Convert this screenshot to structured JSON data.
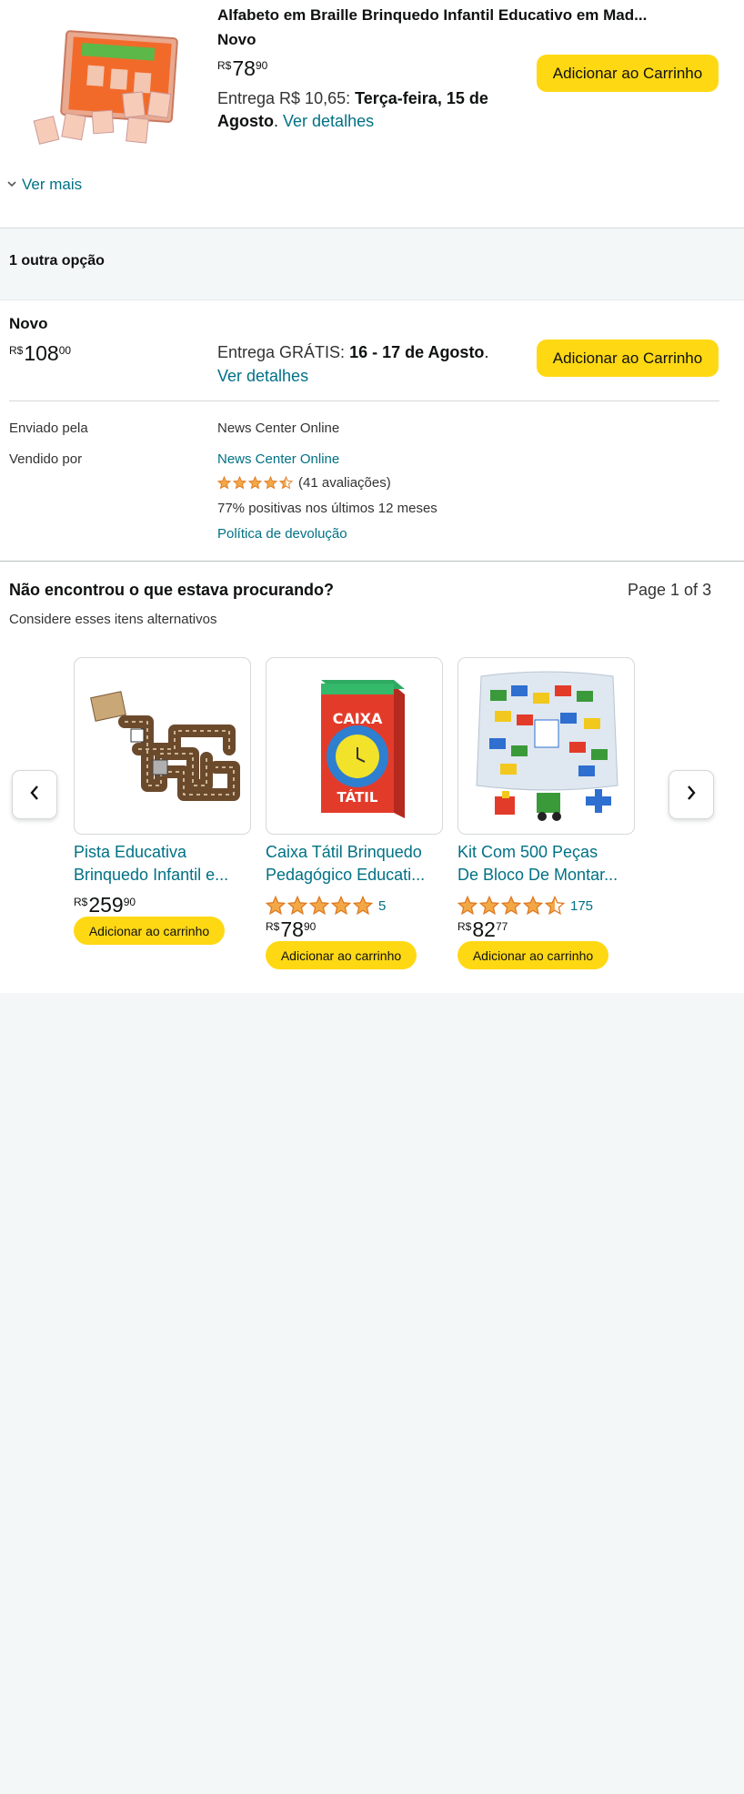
{
  "product": {
    "title": "Alfabeto em Braille Brinquedo Infantil Educativo em Mad...",
    "condition": "Novo",
    "price": {
      "currency": "R$",
      "whole": "78",
      "cents": "90"
    },
    "delivery_prefix": "Entrega R$ 10,65: ",
    "delivery_date_line1": "Terça-feira, 15 de",
    "delivery_date_line2": "Agosto",
    "delivery_period": ". ",
    "details_link": "Ver detalhes",
    "add_to_cart": "Adicionar ao Carrinho"
  },
  "see_more": "Ver mais",
  "other_options": {
    "heading": "1 outra opção",
    "offer": {
      "condition": "Novo",
      "price": {
        "currency": "R$",
        "whole": "108",
        "cents": "00"
      },
      "delivery_prefix": "Entrega GRÁTIS: ",
      "delivery_dates": "16 - 17 de Agosto",
      "delivery_period": ".",
      "details_link": "Ver detalhes",
      "add_to_cart": "Adicionar ao Carrinho",
      "shipped_by_label": "Enviado pela",
      "shipped_by_value": "News Center Online",
      "sold_by_label": "Vendido por",
      "sold_by_value": "News Center Online",
      "rating_stars": 4.5,
      "rating_count": "(41 avaliações)",
      "positive_text": "77% positivas nos últimos 12 meses",
      "return_policy": "Política de devolução"
    }
  },
  "alternatives": {
    "heading": "Não encontrou o que estava procurando?",
    "page_indicator": "Page 1 of 3",
    "subheading": "Considere esses itens alternativos",
    "items": [
      {
        "title_line1": "Pista Educativa",
        "title_line2": "Brinquedo Infantil e...",
        "price": {
          "currency": "R$",
          "whole": "259",
          "cents": "90"
        },
        "add_to_cart": "Adicionar ao carrinho"
      },
      {
        "title_line1": "Caixa Tátil Brinquedo",
        "title_line2": "Pedagógico Educati...",
        "rating_stars": 5,
        "rating_count": "5",
        "box_top_text": "CAIXA",
        "box_bottom_text": "TÁTIL",
        "price": {
          "currency": "R$",
          "whole": "78",
          "cents": "90"
        },
        "add_to_cart": "Adicionar ao carrinho"
      },
      {
        "title_line1": "Kit Com 500 Peças",
        "title_line2": "De Bloco De Montar...",
        "rating_stars": 4.5,
        "rating_count": "175",
        "price": {
          "currency": "R$",
          "whole": "82",
          "cents": "77"
        },
        "add_to_cart": "Adicionar ao carrinho"
      }
    ]
  },
  "colors": {
    "link": "#007185",
    "button": "#ffd814",
    "star": "#f3a847",
    "background": "#f4f7f8"
  }
}
